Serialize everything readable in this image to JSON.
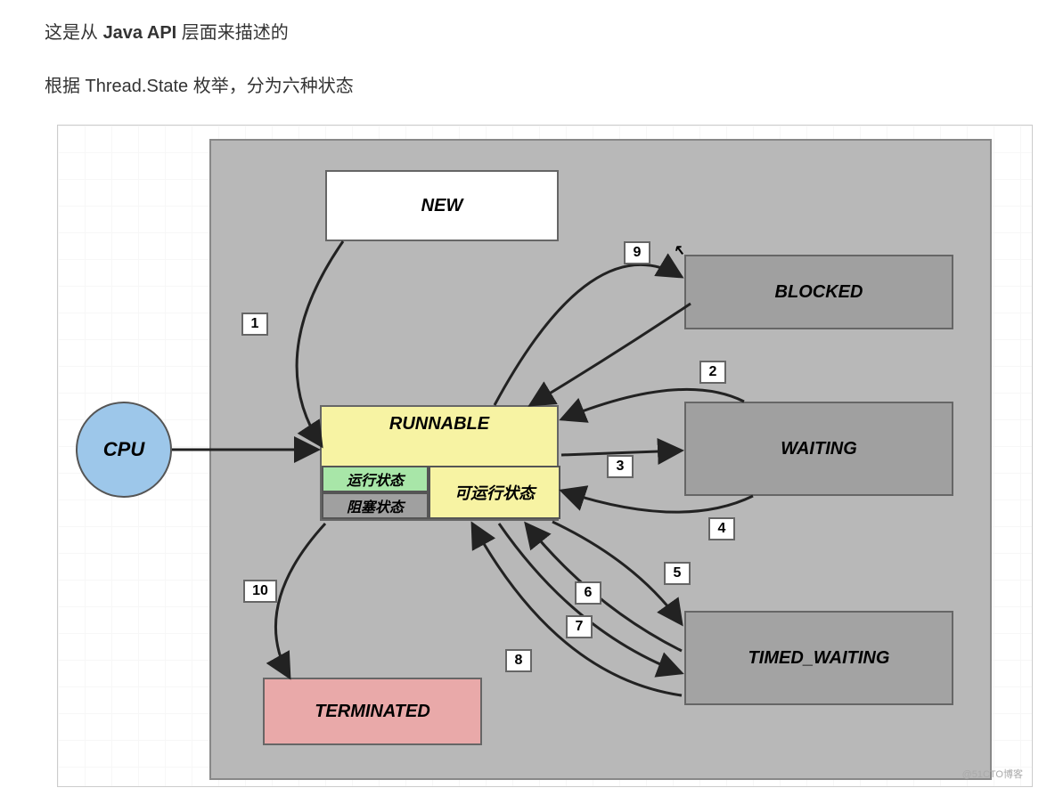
{
  "intro": {
    "line1_pre": "这是从 ",
    "line1_bold": "Java API",
    "line1_post": " 层面来描述的",
    "line2": "根据 Thread.State 枚举，分为六种状态"
  },
  "nodes": {
    "cpu": "CPU",
    "new": "NEW",
    "runnable": "RUNNABLE",
    "running_sub": "运行状态",
    "blockedsub": "阻塞状态",
    "runnable_sub": "可运行状态",
    "blocked": "BLOCKED",
    "waiting": "WAITING",
    "timed_waiting": "TIMED_WAITING",
    "terminated": "TERMINATED"
  },
  "edges": {
    "e1": "1",
    "e2": "2",
    "e3": "3",
    "e4": "4",
    "e5": "5",
    "e6": "6",
    "e7": "7",
    "e8": "8",
    "e9": "9",
    "e10": "10"
  },
  "watermark": "@51CTO博客"
}
